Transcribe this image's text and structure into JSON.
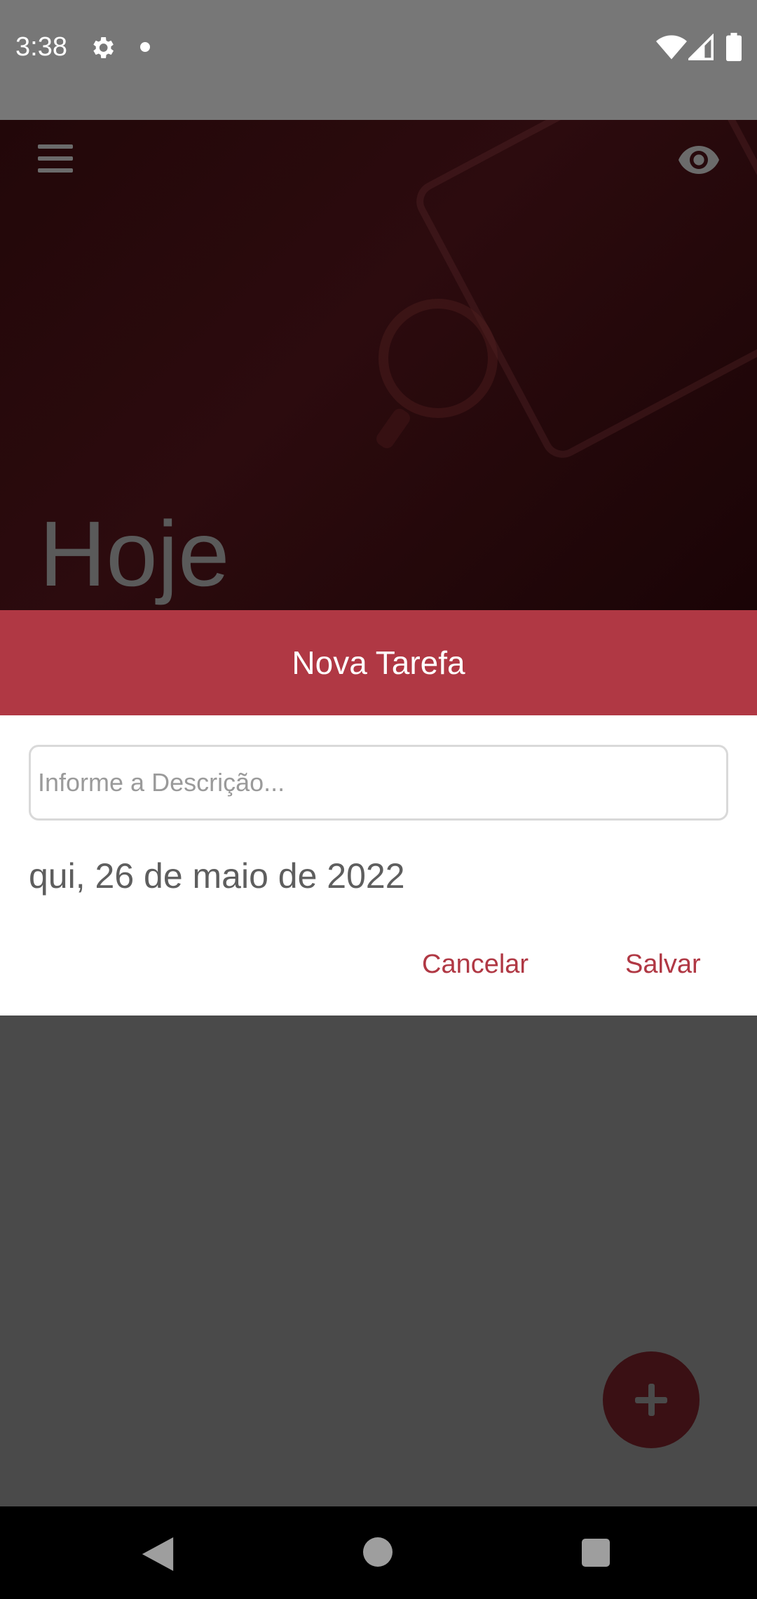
{
  "status_bar": {
    "time": "3:38",
    "icons": [
      "gear-icon",
      "notification-dot-icon",
      "wifi-icon",
      "signal-icon",
      "battery-icon"
    ]
  },
  "header": {
    "title": "Hoje",
    "menu_icon": "hamburger-menu-icon",
    "visibility_icon": "eye-icon"
  },
  "dialog": {
    "title": "Nova Tarefa",
    "description_placeholder": "Informe a Descrição...",
    "description_value": "",
    "date": "qui, 26 de maio de 2022",
    "cancel_label": "Cancelar",
    "save_label": "Salvar"
  },
  "fab": {
    "icon": "plus-icon"
  },
  "nav_bar": {
    "icons": [
      "back-icon",
      "home-icon",
      "recents-icon"
    ]
  },
  "colors": {
    "accent": "#b03844",
    "overlay": "#4a4a4a",
    "status_bar": "#777777"
  }
}
